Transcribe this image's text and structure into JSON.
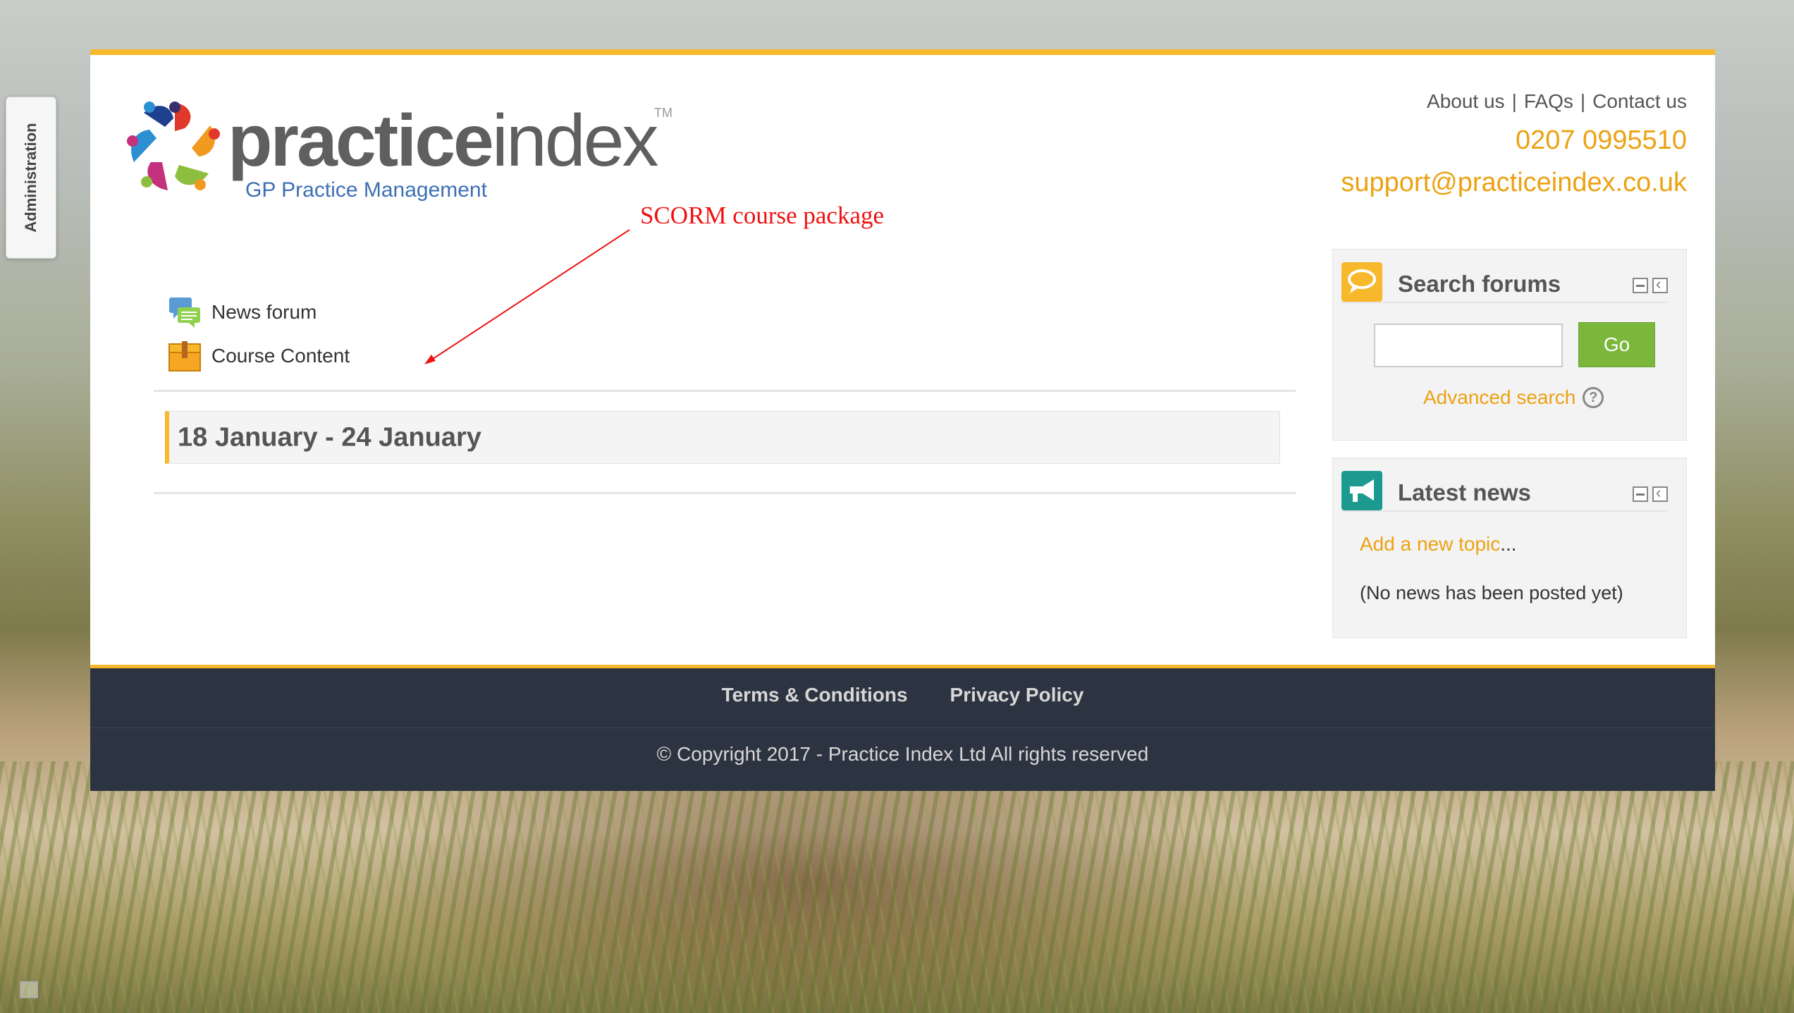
{
  "sidebar": {
    "admin_label": "Administration"
  },
  "header": {
    "logo": {
      "word_bold": "practice",
      "word_light": "index",
      "trademark": "TM",
      "tagline": "GP Practice Management"
    },
    "links": [
      "About us",
      "FAQs",
      "Contact us"
    ],
    "separator": "|",
    "phone": "0207 0995510",
    "email": "support@practiceindex.co.uk"
  },
  "annotation": {
    "text": "SCORM course package",
    "color": "#ee1111"
  },
  "activities": [
    {
      "label": "News forum",
      "icon": "forum-icon"
    },
    {
      "label": "Course Content",
      "icon": "scorm-package-icon"
    }
  ],
  "section": {
    "title": "18 January - 24 January"
  },
  "search_block": {
    "title": "Search forums",
    "input_value": "",
    "go_label": "Go",
    "advanced_label": "Advanced search",
    "help_symbol": "?"
  },
  "news_block": {
    "title": "Latest news",
    "add_topic": "Add a new topic",
    "ellipsis": "...",
    "empty_text": "(No news has been posted yet)"
  },
  "footer": {
    "links": [
      "Terms & Conditions",
      "Privacy Policy"
    ],
    "copyright": "© Copyright 2017 - Practice Index Ltd All rights reserved"
  },
  "colors": {
    "accent": "#f7b92b",
    "link": "#eba213",
    "go_button": "#7ab73a",
    "footer_bg": "#2d3441",
    "search_icon_bg": "#f7b92b",
    "news_icon_bg": "#1d9a8f"
  }
}
